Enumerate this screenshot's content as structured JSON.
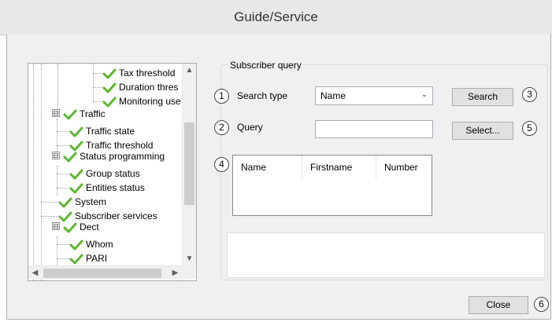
{
  "window": {
    "title": "Guide/Service"
  },
  "tree": {
    "items": [
      {
        "label": "Tax threshold",
        "level": 3
      },
      {
        "label": "Duration thres",
        "level": 3
      },
      {
        "label": "Monitoring use",
        "level": 3
      },
      {
        "label": "Traffic",
        "level": 1,
        "expander": "⊟"
      },
      {
        "label": "Traffic state",
        "level": 2
      },
      {
        "label": "Traffic threshold",
        "level": 2
      },
      {
        "label": "Status programming",
        "level": 1,
        "expander": "⊟"
      },
      {
        "label": "Group status",
        "level": 2
      },
      {
        "label": "Entities status",
        "level": 2
      },
      {
        "label": "System",
        "level": 1
      },
      {
        "label": "Subscriber services",
        "level": 1
      },
      {
        "label": "Dect",
        "level": 1,
        "expander": "⊟"
      },
      {
        "label": "Whom",
        "level": 2
      },
      {
        "label": "PARI",
        "level": 2
      }
    ]
  },
  "subscriber_query": {
    "group_label": "Subscriber query",
    "search_type_label": "Search type",
    "search_type_value": "Name",
    "query_label": "Query",
    "query_value": "",
    "search_button": "Search",
    "select_button": "Select...",
    "columns": [
      "Name",
      "Firstname",
      "Number"
    ]
  },
  "markers": [
    "1",
    "2",
    "3",
    "4",
    "5",
    "6"
  ],
  "footer": {
    "close_button": "Close"
  },
  "colors": {
    "check_green": "#5cb82e",
    "window_bg": "#f0f0f0"
  }
}
